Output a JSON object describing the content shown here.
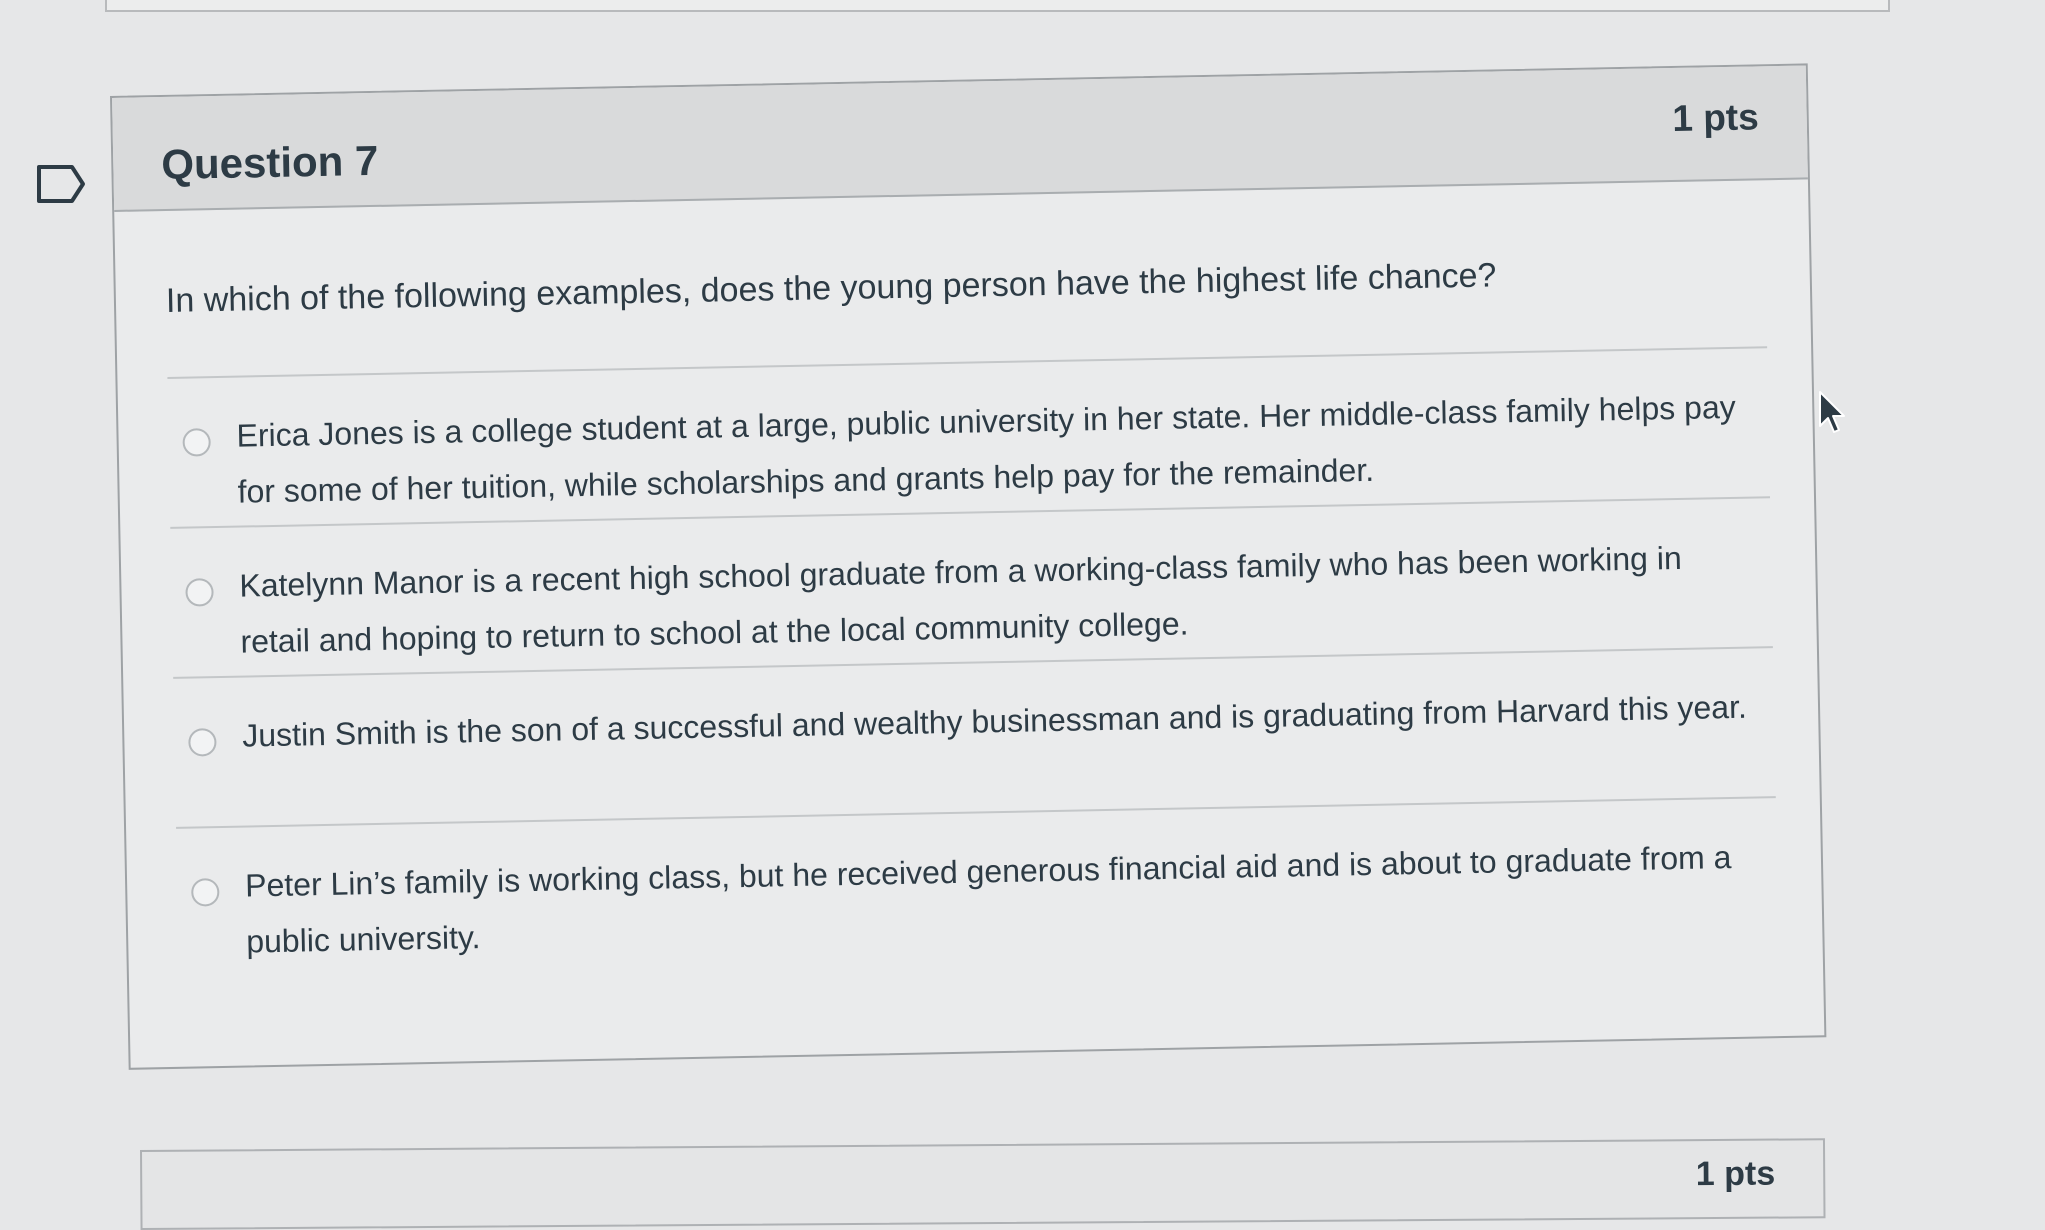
{
  "question": {
    "title": "Question 7",
    "points": "1 pts",
    "text": "In which of the following examples, does the young person have the highest life chance?",
    "answers": [
      {
        "label": "Erica Jones is a college student at a large, public university in her state. Her middle-class family helps pay for some of her tuition, while scholarships and grants help pay for the remainder."
      },
      {
        "label": "Katelynn Manor is a recent high school graduate from a working-class family who has been working in retail and hoping to return to school at the local community college."
      },
      {
        "label": "Justin Smith is the son of a successful and wealthy businessman and is graduating from Harvard this year."
      },
      {
        "label": "Peter Lin’s family is working class, but he received generous financial aid and is about to graduate from a public university."
      }
    ]
  },
  "next_question": {
    "points": "1 pts"
  },
  "icons": {
    "flag": "flag-question-icon",
    "radio": "radio-button-icon",
    "cursor": "mouse-pointer-icon"
  },
  "colors": {
    "text": "#2d3b45",
    "header_bg": "#d9dadb",
    "body_bg": "#eaebec",
    "border": "#9ea2a5"
  }
}
